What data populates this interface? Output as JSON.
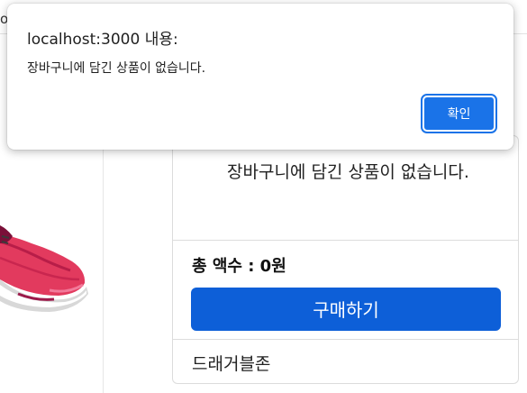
{
  "page": {
    "top_edge_text": "o.",
    "cart": {
      "empty_message": "장바구니에 담긴 상품이 없습니다.",
      "total_label": "총 액수 : 0원",
      "buy_button_label": "구매하기",
      "drag_zone_label": "드래거블존"
    }
  },
  "alert": {
    "title": "localhost:3000 내용:",
    "message": "장바구니에 담긴 상품이 없습니다.",
    "ok_label": "확인"
  },
  "colors": {
    "buy_button": "#0d5fd8",
    "alert_ok": "#1a73e8",
    "shoe_primary": "#e23a5e"
  }
}
